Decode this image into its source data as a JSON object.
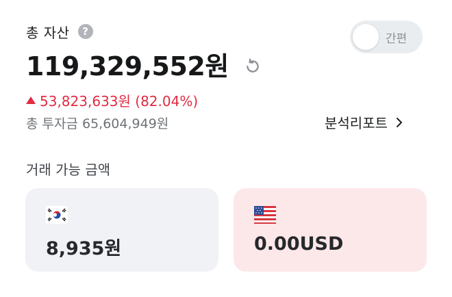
{
  "header": {
    "title": "총 자산",
    "help_icon": "question-circle-icon",
    "toggle_label": "간편",
    "toggle_on": false
  },
  "summary": {
    "total_assets": "119,329,552원",
    "refresh_icon": "refresh-icon",
    "change_text": "53,823,633원 (82.04%)",
    "change_color": "#e22a42",
    "total_invested": "총 투자금 65,604,949원"
  },
  "report_link": {
    "label": "분석리포트"
  },
  "available": {
    "section_title": "거래 가능 금액",
    "cards": [
      {
        "currency_icon": "korea-flag-icon",
        "amount": "8,935원",
        "bg": "#f1f2f6"
      },
      {
        "currency_icon": "usa-flag-icon",
        "amount": "0.00USD",
        "bg": "#fde8e9"
      }
    ]
  }
}
